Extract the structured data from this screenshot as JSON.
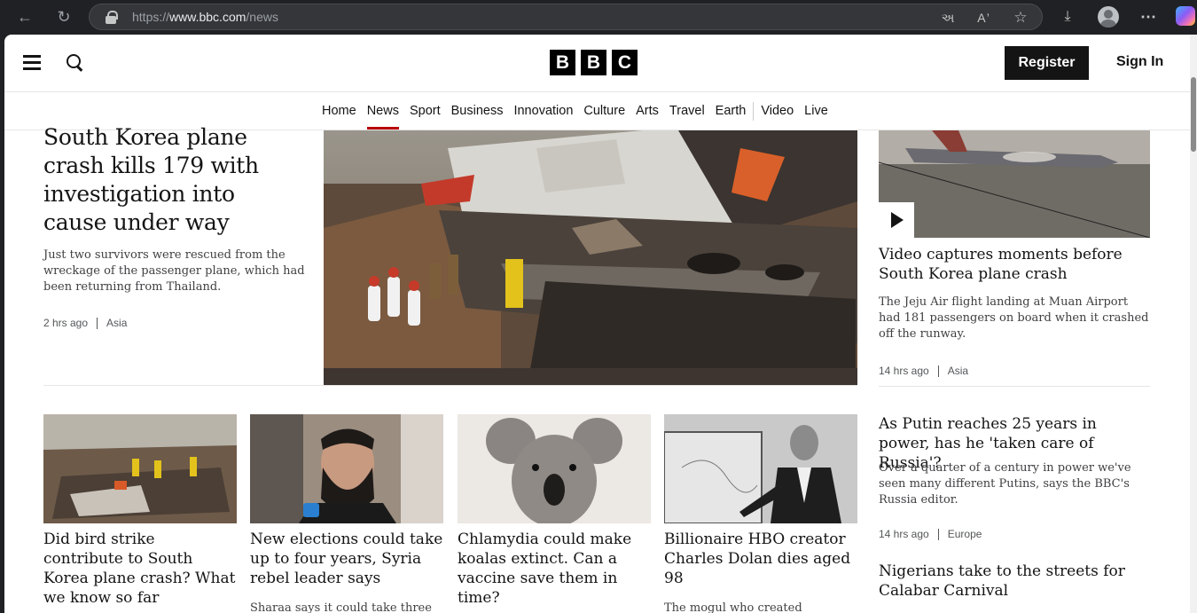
{
  "browser": {
    "url_prefix": "https://",
    "url_domain": "www.bbc.com",
    "url_path": "/news"
  },
  "header": {
    "logo_letters": [
      "B",
      "B",
      "C"
    ],
    "register_label": "Register",
    "signin_label": "Sign In"
  },
  "nav": {
    "items": [
      "Home",
      "News",
      "Sport",
      "Business",
      "Innovation",
      "Culture",
      "Arts",
      "Travel",
      "Earth",
      "Video",
      "Live"
    ],
    "active": "News"
  },
  "lead": {
    "title": "South Korea plane crash kills 179 with investigation into cause under way",
    "summary": "Just two survivors were rescued from the wreckage of the passenger plane, which had been returning from Thailand.",
    "time": "2 hrs ago",
    "tag": "Asia"
  },
  "side_story": {
    "title": "Video captures moments before South Korea plane crash",
    "summary": "The Jeju Air flight landing at Muan Airport had 181 passengers on board when it crashed off the runway.",
    "time": "14 hrs ago",
    "tag": "Asia"
  },
  "cards": [
    {
      "title": "Did bird strike contribute to South Korea plane crash? What we know so far",
      "summary": ""
    },
    {
      "title": "New elections could take up to four years, Syria rebel leader says",
      "summary": "Sharaa says it could take three"
    },
    {
      "title": "Chlamydia could make koalas extinct. Can a vaccine save them in time?",
      "summary": ""
    },
    {
      "title": "Billionaire HBO creator Charles Dolan dies aged 98",
      "summary": "The mogul who created"
    }
  ],
  "right_story_2": {
    "title": "As Putin reaches 25 years in power, has he 'taken care of Russia'?",
    "summary": "Over a quarter of a century in power we've seen many different Putins, says the BBC's Russia editor.",
    "time": "14 hrs ago",
    "tag": "Europe"
  },
  "right_story_3": {
    "title": "Nigerians take to the streets for Calabar Carnival"
  },
  "colors": {
    "accent": "#b80000",
    "ink": "#141414",
    "chrome": "#202124"
  }
}
